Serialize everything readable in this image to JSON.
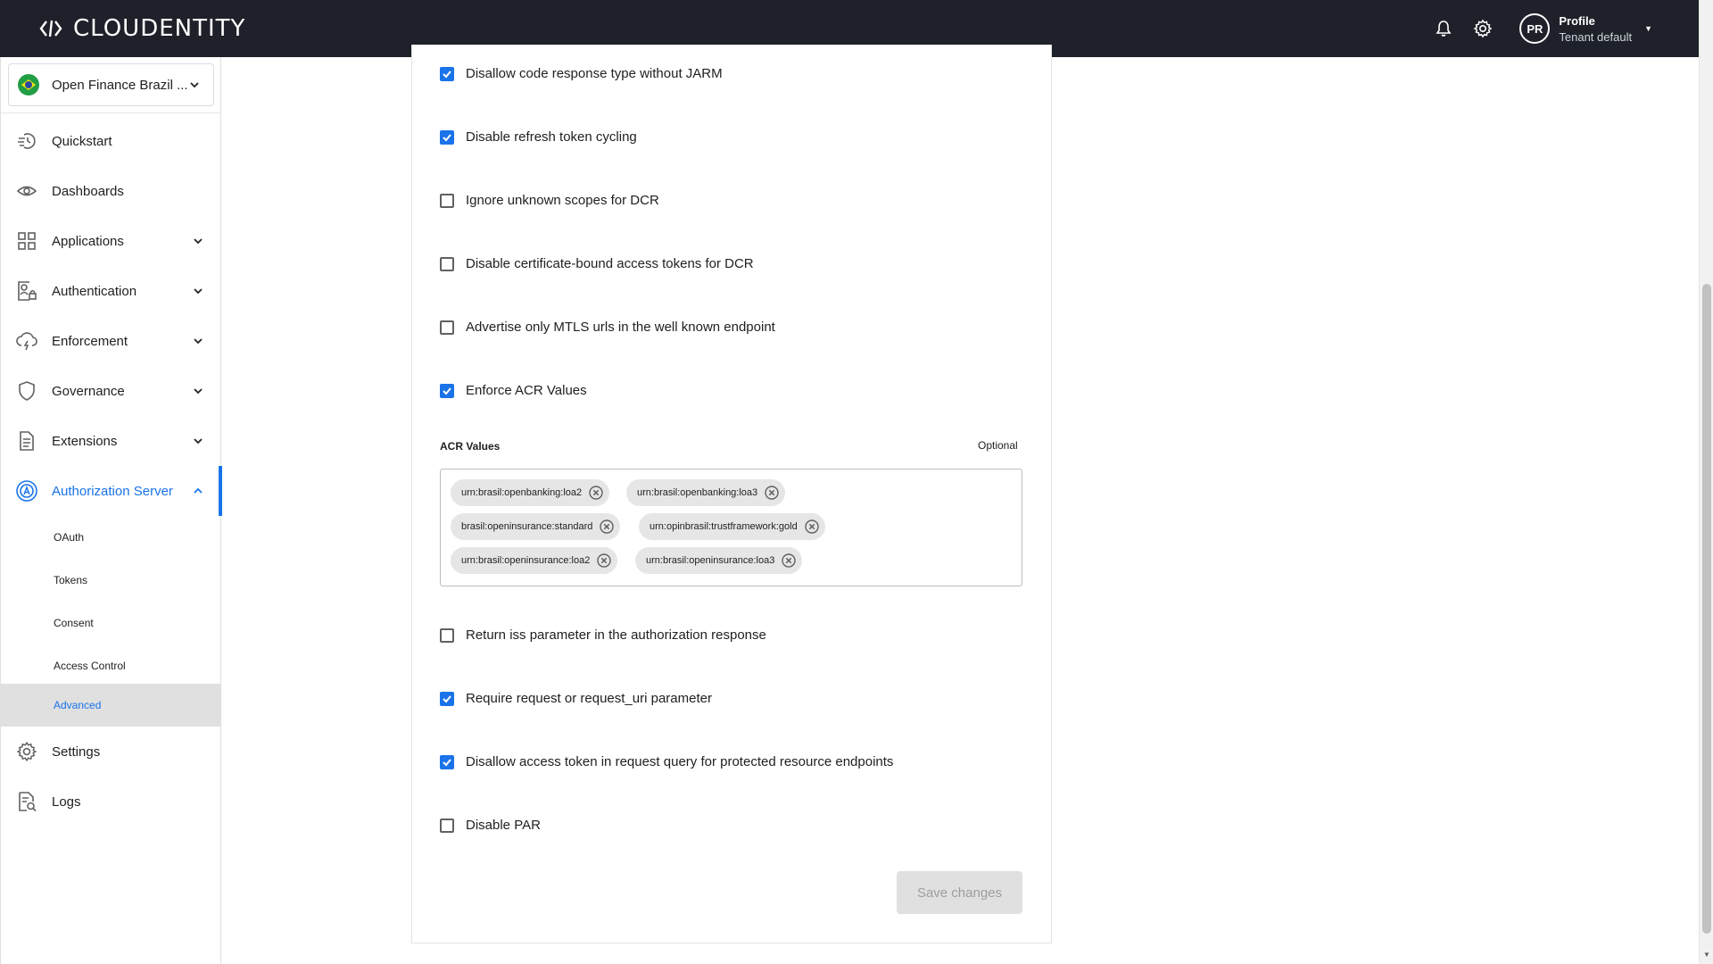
{
  "header": {
    "brand": "CLOUDENTITY",
    "profile_name": "Profile",
    "profile_tenant": "Tenant default",
    "avatar_initials": "PR",
    "bg_color": "#1e2129"
  },
  "sidebar": {
    "workspace": "Open Finance Brazil ...",
    "items": [
      {
        "label": "Quickstart",
        "icon": "quickstart-icon"
      },
      {
        "label": "Dashboards",
        "icon": "eye-icon"
      },
      {
        "label": "Applications",
        "icon": "grid-icon"
      },
      {
        "label": "Authentication",
        "icon": "authentication-icon"
      },
      {
        "label": "Enforcement",
        "icon": "enforcement-icon"
      },
      {
        "label": "Governance",
        "icon": "shield-icon"
      },
      {
        "label": "Extensions",
        "icon": "document-icon"
      },
      {
        "label": "Authorization Server",
        "icon": "authorization-server-icon"
      }
    ],
    "subitems": [
      "OAuth",
      "Tokens",
      "Consent",
      "Access Control",
      "Advanced"
    ],
    "bottom_items": [
      {
        "label": "Settings",
        "icon": "gear-icon"
      },
      {
        "label": "Logs",
        "icon": "logs-icon"
      }
    ],
    "accent_color": "#1a73e8"
  },
  "form": {
    "options_top": [
      {
        "label": "Disallow code response type without JARM",
        "checked": true
      },
      {
        "label": "Disable refresh token cycling",
        "checked": true
      },
      {
        "label": "Ignore unknown scopes for DCR",
        "checked": false
      },
      {
        "label": "Disable certificate-bound access tokens for DCR",
        "checked": false
      },
      {
        "label": "Advertise only MTLS urls in the well known endpoint",
        "checked": false
      },
      {
        "label": "Enforce ACR Values",
        "checked": true
      }
    ],
    "acr": {
      "title": "ACR Values",
      "optional": "Optional",
      "values": [
        "urn:brasil:openbanking:loa2",
        "urn:brasil:openbanking:loa3",
        "brasil:openinsurance:standard",
        "urn:opinbrasil:trustframework:gold",
        "urn:brasil:openinsurance:loa2",
        "urn:brasil:openinsurance:loa3"
      ]
    },
    "options_bottom": [
      {
        "label": "Return iss parameter in the authorization response",
        "checked": false
      },
      {
        "label": "Require request or request_uri parameter",
        "checked": true
      },
      {
        "label": "Disallow access token in request query for protected resource endpoints",
        "checked": true
      },
      {
        "label": "Disable PAR",
        "checked": false
      }
    ],
    "save_label": "Save changes"
  }
}
